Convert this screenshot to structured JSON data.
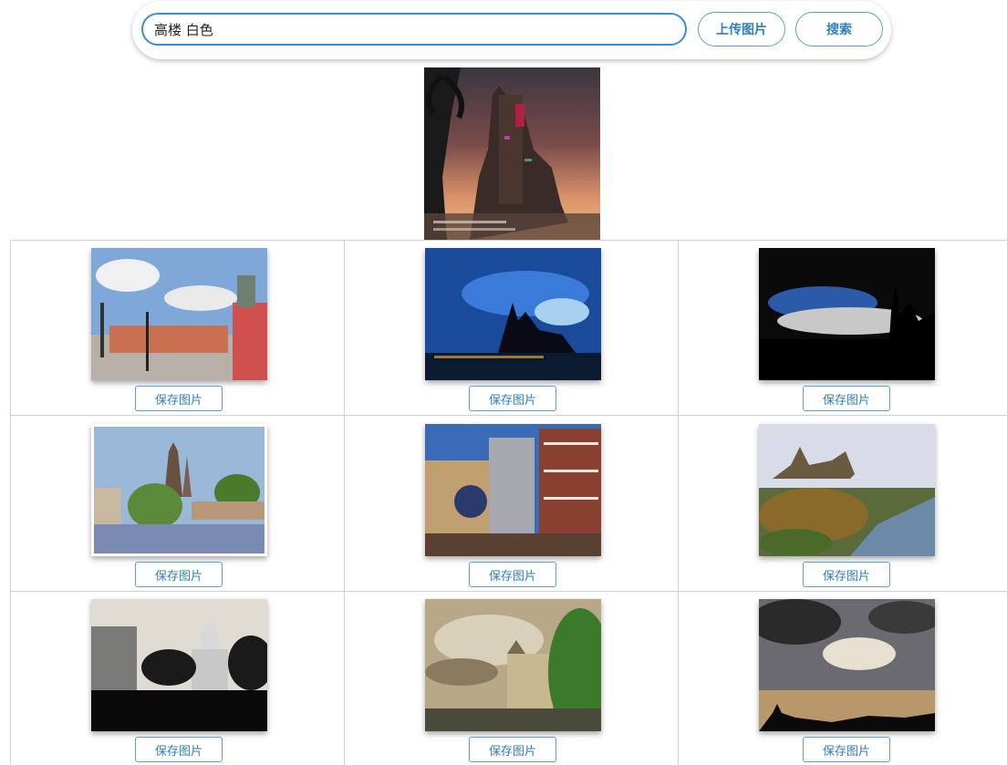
{
  "search": {
    "query": "高楼 白色",
    "upload_label": "上传图片",
    "search_label": "搜索"
  },
  "results": {
    "save_label": "保存图片",
    "items": [
      {
        "description": "castle square with clock tower"
      },
      {
        "description": "night cathedral blue sky"
      },
      {
        "description": "dark gothic silhouette"
      },
      {
        "description": "bridge and towers by river"
      },
      {
        "description": "astronomical clock street"
      },
      {
        "description": "parliament hill over river"
      },
      {
        "description": "capitol dome at dusk"
      },
      {
        "description": "castle under dramatic clouds"
      },
      {
        "description": "sunrays through clouds silhouette"
      }
    ]
  },
  "colors": {
    "accent": "#2f7fc1",
    "border": "#5aa0d8"
  }
}
